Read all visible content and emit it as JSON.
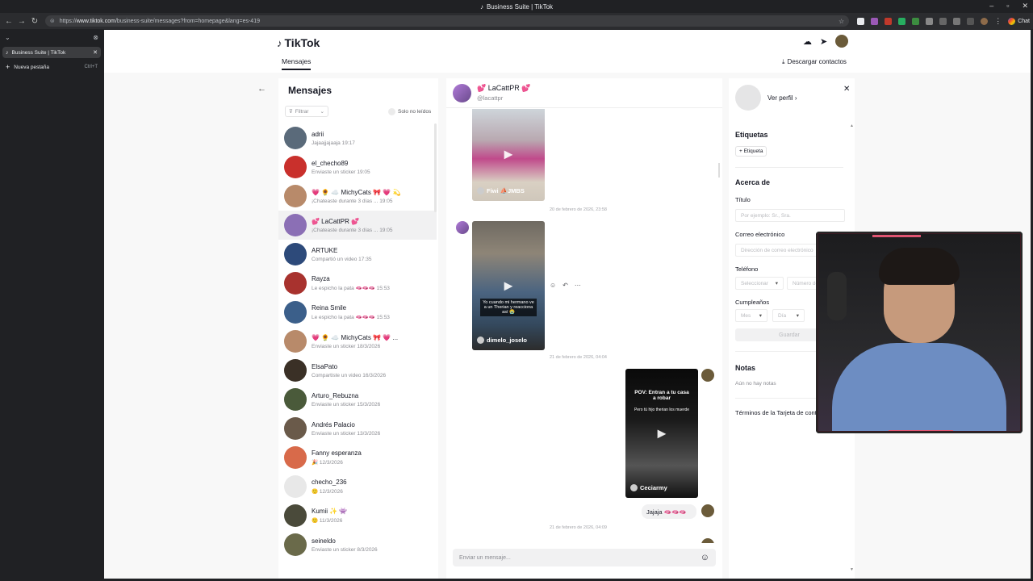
{
  "browser": {
    "window_title": "Business Suite | TikTok",
    "url_prefix": "https://",
    "url_host": "www.tiktok.com",
    "url_path": "/business-suite/messages?from=homepage&lang=es-419",
    "chat_label": "Chat",
    "tab_title": "Business Suite | TikTok",
    "new_tab_label": "Nueva pestaña",
    "new_tab_shortcut": "Ctrl+T"
  },
  "header": {
    "brand": "TikTok",
    "tab_messages": "Mensajes",
    "download_contacts": "Descargar contactos"
  },
  "conversations": {
    "title": "Mensajes",
    "filter_label": "Filtrar",
    "unread_only": "Solo no leídos",
    "items": [
      {
        "name": "adrii",
        "preview": "Jajaajjajaaja 19:17",
        "color": "#5a6a7a"
      },
      {
        "name": "el_checho89",
        "preview": "Enviaste un sticker 19:05",
        "color": "#c9302c"
      },
      {
        "name": "💗 🌻 ☁️ MichyCats 🎀 💗 💫",
        "preview": "¡Chateaste durante 3 días ... 19:05",
        "color": "#b88a6a"
      },
      {
        "name": "💕 LaCattPR 💕",
        "preview": "¡Chateaste durante 3 días ... 19:05",
        "color": "#8b6fb5"
      },
      {
        "name": "ARTUKE",
        "preview": "Compartió un video 17:35",
        "color": "#2d4a7a"
      },
      {
        "name": "Rayza",
        "preview": "Le espicho la pata 🫦🫦🫦 15:53",
        "color": "#a8322e"
      },
      {
        "name": "Reina Smile",
        "preview": "Le espicho la pata 🫦🫦🫦 15:53",
        "color": "#3b5f8a"
      },
      {
        "name": "💗 🌻 ☁️ MichyCats 🎀 💗 ...",
        "preview": "Enviaste un sticker 18/3/2026",
        "color": "#b88a6a"
      },
      {
        "name": "ElsaPato",
        "preview": "Compartiste un video 16/3/2026",
        "color": "#3a3026"
      },
      {
        "name": "Arturo_Rebuzna",
        "preview": "Enviaste un sticker 15/3/2026",
        "color": "#4a5a3a"
      },
      {
        "name": "Andrés Palacio",
        "preview": "Enviaste un sticker 13/3/2026",
        "color": "#6a5a4a"
      },
      {
        "name": "Fanny esperanza",
        "preview": "🎉 12/3/2026",
        "color": "#d86a4a"
      },
      {
        "name": "checho_236",
        "preview": "🙂 12/3/2026",
        "color": "#e8e8e8"
      },
      {
        "name": "Kumii ✨ 👾",
        "preview": "🙂 11/3/2026",
        "color": "#4a4a3a"
      },
      {
        "name": "seineldo",
        "preview": "Enviaste un sticker 8/3/2026",
        "color": "#6a6a4a"
      }
    ]
  },
  "chat": {
    "name": "💕 LaCattPR 💕",
    "username": "@lacattpr",
    "video1_author": "Fiwi ⛵JMBS",
    "ts1": "20 de febrero de 2026, 23:58",
    "video2_caption": "Yo cuando mi hermano ve a un Therian y reacciona así 😭",
    "video2_author": "dimelo_joselo",
    "ts2": "21 de febrero de 2026, 04:04",
    "video3_title": "POV: Entran a tu casa a robar",
    "video3_sub": "Pero tú hijo therian los muerde",
    "video3_author": "Ceciarmy",
    "bubble_text": "Jajaja 🫦🫦🫦",
    "ts3": "21 de febrero de 2026, 04:09",
    "input_placeholder": "Enviar un mensaje..."
  },
  "profile": {
    "view_profile": "Ver perfil",
    "tags_title": "Etiquetas",
    "tag_button": "+ Etiqueta",
    "about_title": "Acerca de",
    "title_label": "Título",
    "title_placeholder": "Por ejemplo: Sr., Sra.",
    "email_label": "Correo electrónico",
    "email_placeholder": "Dirección de correo electrónico",
    "phone_label": "Teléfono",
    "phone_select": "Seleccionar",
    "phone_placeholder": "Número de teléfono",
    "birthday_label": "Cumpleaños",
    "month_placeholder": "Mes",
    "day_placeholder": "Día",
    "save_label": "Guardar",
    "notes_title": "Notas",
    "no_notes": "Aún no hay notas",
    "terms": "Términos de la Tarjeta de contacto"
  },
  "colors": {
    "accent_pink": "#fe2c55",
    "text_primary": "#161823",
    "text_secondary": "#8a8b91"
  }
}
